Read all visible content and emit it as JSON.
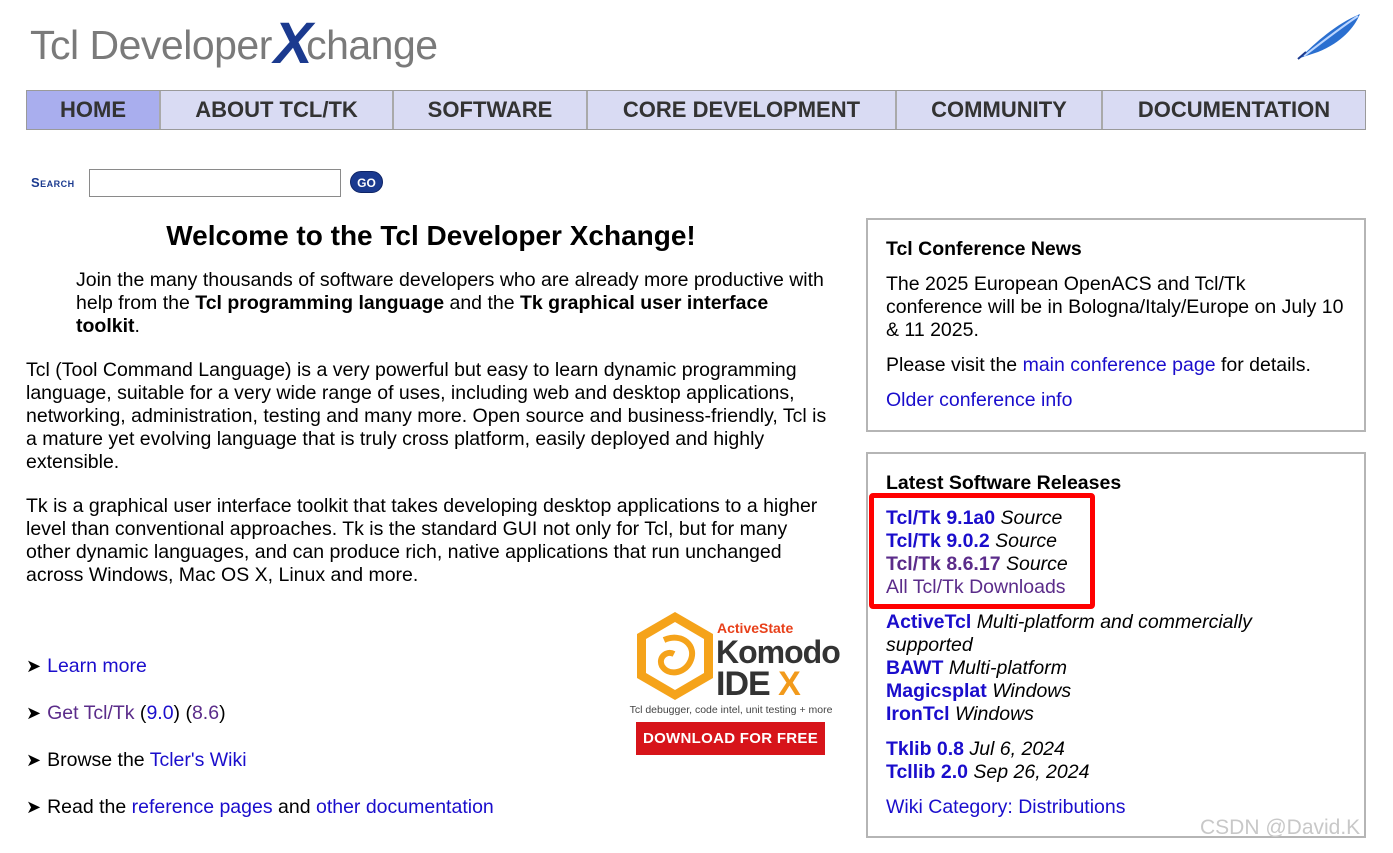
{
  "header": {
    "logo_part1": "Tcl Developer",
    "logo_x": "X",
    "logo_part2": "change"
  },
  "nav": [
    {
      "label": "HOME",
      "active": true
    },
    {
      "label": "ABOUT TCL/TK"
    },
    {
      "label": "SOFTWARE"
    },
    {
      "label": "CORE DEVELOPMENT"
    },
    {
      "label": "COMMUNITY"
    },
    {
      "label": "DOCUMENTATION"
    }
  ],
  "search": {
    "label": "Search",
    "value": "",
    "go": "GO"
  },
  "main": {
    "welcome": "Welcome to the Tcl Developer Xchange!",
    "intro": {
      "t1": "Join the many thousands of software developers who are already more productive with help from the ",
      "b1": "Tcl programming language",
      "t2": " and the ",
      "b2": "Tk graphical user interface toolkit",
      "t3": "."
    },
    "para1": "Tcl (Tool Command Language) is a very powerful but easy to learn dynamic programming language, suitable for a very wide range of uses, including web and desktop applications, networking, administration, testing and many more. Open source and business-friendly, Tcl is a mature yet evolving language that is truly cross platform, easily deployed and highly extensible.",
    "para2": "Tk is a graphical user interface toolkit that takes developing desktop applications to a higher level than conventional approaches. Tk is the standard GUI not only for Tcl, but for many other dynamic languages, and can produce rich, native applications that run unchanged across Windows, Mac OS X, Linux and more."
  },
  "bullets": {
    "arrow": "➤",
    "learn_more": "Learn more",
    "get_tcltk": "Get Tcl/Tk",
    "open1": " (",
    "v90": "9.0",
    "mid": ") (",
    "v86": "8.6",
    "close": ")",
    "browse_prefix": "Browse the ",
    "wiki": "Tcler's Wiki",
    "read_prefix": "Read the ",
    "ref_pages": "reference pages",
    "and": " and ",
    "other_doc": "other documentation"
  },
  "ad": {
    "brand": "ActiveState",
    "komodo": "Komodo",
    "ide": "IDE",
    "x": "X",
    "tagline": "Tcl debugger, code intel, unit testing + more",
    "button": "DOWNLOAD FOR FREE"
  },
  "conference": {
    "title": "Tcl Conference News",
    "text": "The 2025 European OpenACS and Tcl/Tk conference will be in Bologna/Italy/Europe on July 10 & 11 2025.",
    "visit_prefix": "Please visit the ",
    "visit_link": "main conference page",
    "visit_suffix": " for details.",
    "older": "Older conference info"
  },
  "releases": {
    "title": "Latest Software Releases",
    "core": [
      {
        "name": "Tcl/Tk 9.1a0",
        "desc": "Source"
      },
      {
        "name": "Tcl/Tk 9.0.2",
        "desc": "Source"
      },
      {
        "name": "Tcl/Tk 8.6.17",
        "desc": "Source"
      }
    ],
    "all_downloads": "All Tcl/Tk Downloads",
    "dists": [
      {
        "name": "ActiveTcl",
        "desc": "Multi-platform and commercially"
      },
      {
        "name": "",
        "desc": "supported"
      },
      {
        "name": "BAWT",
        "desc": "Multi-platform"
      },
      {
        "name": "Magicsplat",
        "desc": "Windows"
      },
      {
        "name": "IronTcl",
        "desc": "Windows"
      }
    ],
    "libs": [
      {
        "name": "Tklib 0.8",
        "desc": "Jul 6, 2024"
      },
      {
        "name": "Tcllib 2.0",
        "desc": "Sep 26, 2024"
      }
    ],
    "wiki_category": "Wiki Category: Distributions"
  },
  "watermark": "CSDN @David.K"
}
